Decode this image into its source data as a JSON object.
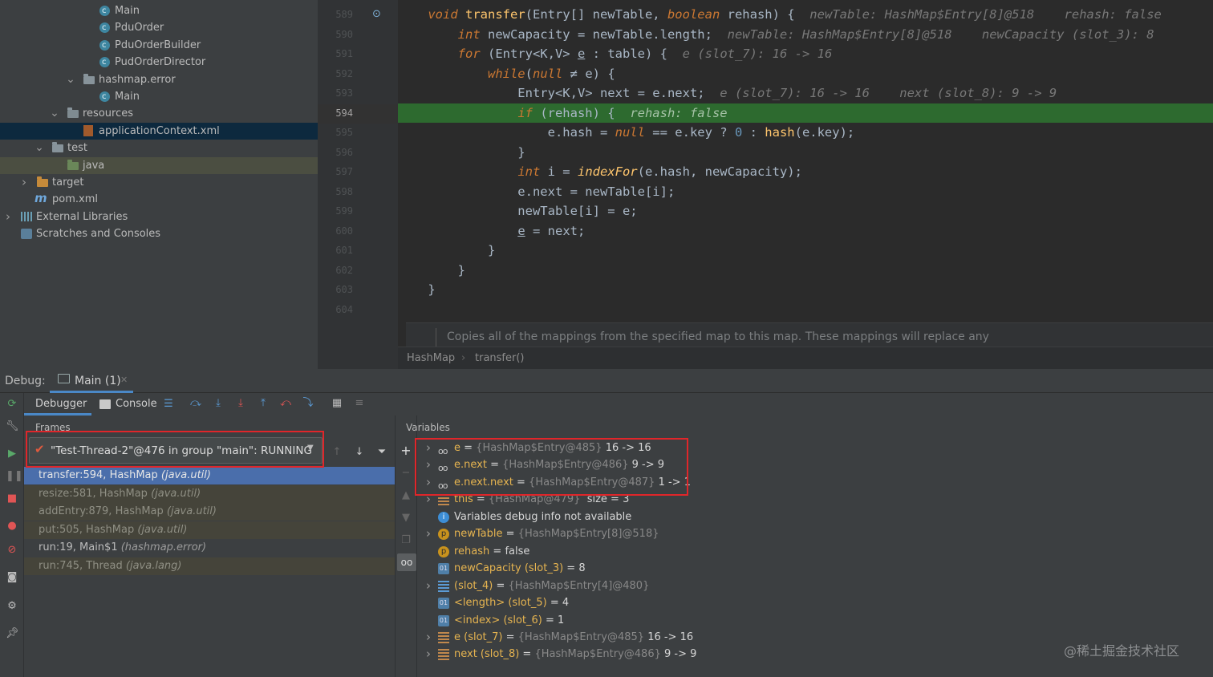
{
  "tree": [
    {
      "label": "Main",
      "icon": "class-icon",
      "indent": 124,
      "arrow": ""
    },
    {
      "label": "PduOrder",
      "icon": "class-icon",
      "indent": 124,
      "arrow": ""
    },
    {
      "label": "PduOrderBuilder",
      "icon": "class-icon",
      "indent": 124,
      "arrow": ""
    },
    {
      "label": "PudOrderDirector",
      "icon": "class-icon",
      "indent": 124,
      "arrow": ""
    },
    {
      "label": "hashmap.error",
      "icon": "package-icon",
      "indent": 104,
      "arrow": "v"
    },
    {
      "label": "Main",
      "icon": "class-icon",
      "indent": 124,
      "arrow": ""
    },
    {
      "label": "resources",
      "icon": "resources-folder-icon",
      "indent": 84,
      "arrow": "v"
    },
    {
      "label": "applicationContext.xml",
      "icon": "xml-file-icon",
      "indent": 104,
      "arrow": "",
      "state": "sel"
    },
    {
      "label": "test",
      "icon": "folder-icon",
      "indent": 65,
      "arrow": "v"
    },
    {
      "label": "java",
      "icon": "test-source-folder-icon",
      "indent": 84,
      "arrow": "",
      "state": "hl"
    },
    {
      "label": "target",
      "icon": "target-folder-icon",
      "indent": 46,
      "arrow": ">"
    },
    {
      "label": "pom.xml",
      "icon": "maven-icon",
      "indent": 46,
      "arrow": ""
    },
    {
      "label": "External Libraries",
      "icon": "library-icon",
      "indent": 26,
      "arrow": ">"
    },
    {
      "label": "Scratches and Consoles",
      "icon": "scratches-icon",
      "indent": 26,
      "arrow": ""
    }
  ],
  "gutter_lines": [
    "589",
    "590",
    "591",
    "592",
    "593",
    "594",
    "595",
    "596",
    "597",
    "598",
    "599",
    "600",
    "601",
    "602",
    "603",
    "604"
  ],
  "current_line": "594",
  "code": [
    {
      "indent": "    ",
      "html": "<span class='kw'>void</span> <span class='fn'>transfer</span>(Entry[] newTable, <span class='kw'>boolean</span> rehash) {  <span class='hint'>newTable: HashMap$Entry[8]@518    rehash: false</span>"
    },
    {
      "indent": "        ",
      "html": "<span class='kw'>int</span> newCapacity = newTable.length;  <span class='hint'>newTable: HashMap$Entry[8]@518    newCapacity (slot_3): 8</span>"
    },
    {
      "indent": "        ",
      "html": "<span class='kw'>for</span> (Entry&lt;K,V&gt; <span class='ul'>e</span> : table) {  <span class='hint'>e (slot_7): 16 -&gt; 16</span>"
    },
    {
      "indent": "            ",
      "html": "<span class='kw'>while</span>(<span class='kw'>null</span> ≠ e) {"
    },
    {
      "indent": "                ",
      "html": "Entry&lt;K,V&gt; next = e.next;  <span class='hint'>e (slot_7): 16 -&gt; 16    next (slot_8): 9 -&gt; 9</span>"
    },
    {
      "indent": "                ",
      "html": "<span class='kw'>if</span> (rehash) {  <span class='hintg'>rehash: false</span>",
      "exec": true
    },
    {
      "indent": "                    ",
      "html": "e.hash = <span class='kw'>null</span> == e.key ? <span class='num'>0</span> : <span class='fn'>hash</span>(e.key);"
    },
    {
      "indent": "                ",
      "html": "}"
    },
    {
      "indent": "                ",
      "html": "<span class='kw'>int</span> i = <span class='fni'>indexFor</span>(e.hash, newCapacity);"
    },
    {
      "indent": "                ",
      "html": "e.next = newTable[i];"
    },
    {
      "indent": "                ",
      "html": "newTable[i] = e;"
    },
    {
      "indent": "                ",
      "html": "<span class='ul'>e</span> = next;"
    },
    {
      "indent": "            ",
      "html": "}"
    },
    {
      "indent": "        ",
      "html": "}"
    },
    {
      "indent": "    ",
      "html": "}"
    }
  ],
  "doc_comment": "Copies all of the mappings from the specified map to this map. These mappings will replace any",
  "breadcrumb": [
    "HashMap",
    "transfer()"
  ],
  "debug": {
    "label": "Debug:",
    "session_tab": "Main (1)",
    "tabs": [
      "Debugger",
      "Console"
    ],
    "frames_title": "Frames",
    "variables_title": "Variables",
    "thread": "\"Test-Thread-2\"@476 in group \"main\": RUNNING"
  },
  "frames": [
    {
      "method": "transfer:594, HashMap",
      "pkg": "(java.util)",
      "kind": "sel"
    },
    {
      "method": "resize:581, HashMap",
      "pkg": "(java.util)",
      "kind": "lib"
    },
    {
      "method": "addEntry:879, HashMap",
      "pkg": "(java.util)",
      "kind": "lib"
    },
    {
      "method": "put:505, HashMap",
      "pkg": "(java.util)",
      "kind": "lib"
    },
    {
      "method": "run:19, Main$1",
      "pkg": "(hashmap.error)",
      "kind": "usr"
    },
    {
      "method": "run:745, Thread",
      "pkg": "(java.lang)",
      "kind": "lib"
    }
  ],
  "variables": [
    {
      "arrow": ">",
      "icon": "watch-icon",
      "name": "e",
      "rest": " = ",
      "gray": "{HashMap$Entry@485}",
      "val": " 16 -> 16"
    },
    {
      "arrow": ">",
      "icon": "watch-icon",
      "name": "e.next",
      "rest": " = ",
      "gray": "{HashMap$Entry@486}",
      "val": " 9 -> 9"
    },
    {
      "arrow": ">",
      "icon": "watch-icon",
      "name": "e.next.next",
      "rest": " = ",
      "gray": "{HashMap$Entry@487}",
      "val": " 1 -> 1"
    },
    {
      "arrow": ">",
      "icon": "list-icon",
      "name": "this",
      "rest": " = ",
      "gray": "{HashMap@479}",
      "val": "  size = 3"
    },
    {
      "arrow": "",
      "icon": "info-icon",
      "name": "",
      "rest": "",
      "gray": "",
      "val": "Variables debug info not available",
      "plain": true
    },
    {
      "arrow": ">",
      "icon": "param-icon",
      "name": "newTable",
      "rest": " = ",
      "gray": "{HashMap$Entry[8]@518}",
      "val": ""
    },
    {
      "arrow": "",
      "icon": "param-icon",
      "name": "rehash",
      "rest": " = ",
      "gray": "",
      "val": "false"
    },
    {
      "arrow": "",
      "icon": "primitive-icon",
      "name": "newCapacity (slot_3)",
      "rest": " = ",
      "gray": "",
      "val": "8"
    },
    {
      "arrow": ">",
      "icon": "array-icon",
      "name": "(slot_4)",
      "rest": " = ",
      "gray": "{HashMap$Entry[4]@480}",
      "val": ""
    },
    {
      "arrow": "",
      "icon": "primitive-icon",
      "name": "<length> (slot_5)",
      "rest": " = ",
      "gray": "",
      "val": "4"
    },
    {
      "arrow": "",
      "icon": "primitive-icon",
      "name": "<index> (slot_6)",
      "rest": " = ",
      "gray": "",
      "val": "1"
    },
    {
      "arrow": ">",
      "icon": "list-icon",
      "name": "e (slot_7)",
      "rest": " = ",
      "gray": "{HashMap$Entry@485}",
      "val": " 16 -> 16"
    },
    {
      "arrow": ">",
      "icon": "list-icon",
      "name": "next (slot_8)",
      "rest": " = ",
      "gray": "{HashMap$Entry@486}",
      "val": " 9 -> 9"
    }
  ],
  "watermark": "@稀土掘金技术社区",
  "colors": {
    "highlight_box": "#e0262a",
    "exec_line": "#2d6a2f",
    "selected_frame": "#4a6eab"
  }
}
